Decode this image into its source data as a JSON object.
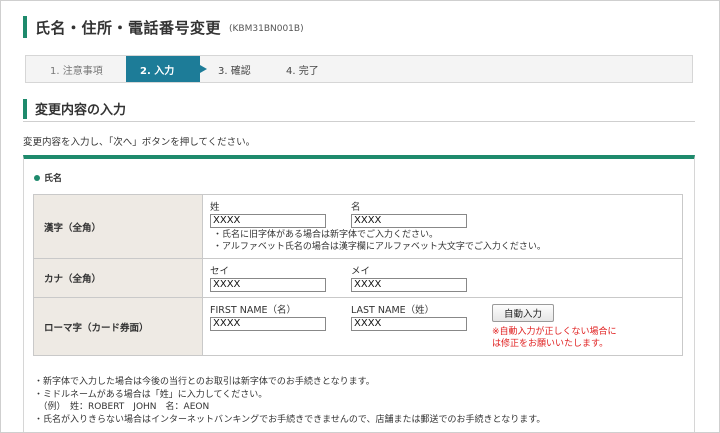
{
  "header": {
    "title": "氏名・住所・電話番号変更",
    "screen_id": "(KBM31BN001B)"
  },
  "steps": [
    {
      "label": "1. 注意事項"
    },
    {
      "label": "2. 入力"
    },
    {
      "label": "3. 確認"
    },
    {
      "label": "4. 完了"
    }
  ],
  "section": {
    "title": "変更内容の入力"
  },
  "instruction": "変更内容を入力し、「次へ」ボタンを押してください。",
  "panel": {
    "label": "氏名"
  },
  "rows": {
    "kanji": {
      "header": "漢字（全角）",
      "sei_label": "姓",
      "sei_value": "XXXX",
      "mei_label": "名",
      "mei_value": "XXXX",
      "note1": "・氏名に旧字体がある場合は新字体でご入力ください。",
      "note2": "・アルファベット氏名の場合は漢字欄にアルファベット大文字でご入力ください。"
    },
    "kana": {
      "header": "カナ（全角）",
      "sei_label": "セイ",
      "sei_value": "XXXX",
      "mei_label": "メイ",
      "mei_value": "XXXX"
    },
    "roman": {
      "header": "ローマ字（カード券面）",
      "first_label": "FIRST NAME（名）",
      "first_value": "XXXX",
      "last_label": "LAST NAME（姓）",
      "last_value": "XXXX",
      "auto_button": "自動入力",
      "warning1": "※自動入力が正しくない場合に",
      "warning2": "は修正をお願いいたします。"
    }
  },
  "notes": [
    "・新字体で入力した場合は今後の当行とのお取引は新字体でのお手続きとなります。",
    "・ミドルネームがある場合は「姓」に入力してください。",
    "　（例）　姓：ROBERT　JOHN　名：AEON",
    "・氏名が入りきらない場合はインターネットバンキングでお手続きできませんので、店舗または郵送でのお手続きとなります。"
  ]
}
